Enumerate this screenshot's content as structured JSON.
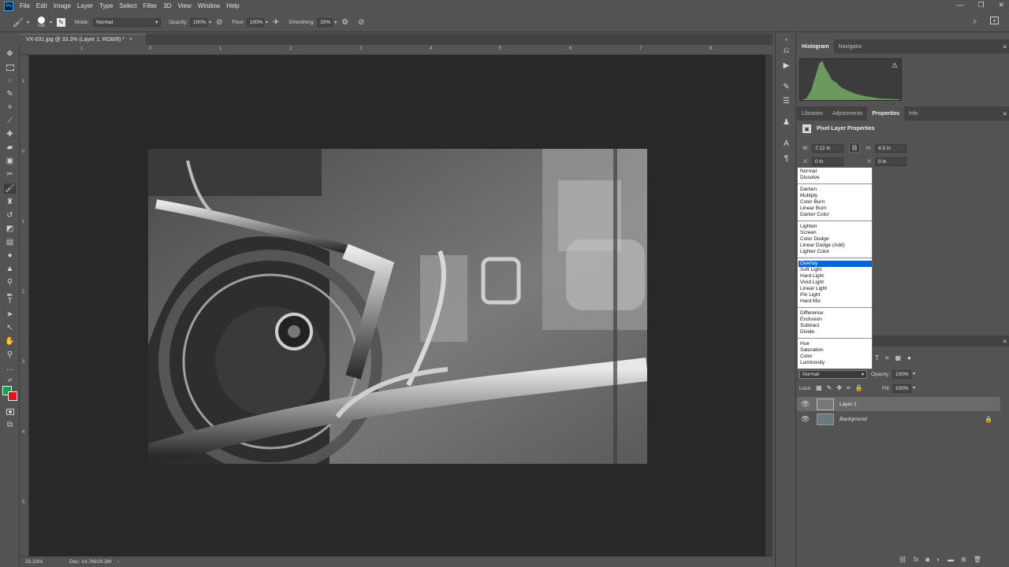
{
  "menu": {
    "logo": "Ps",
    "items": [
      "File",
      "Edit",
      "Image",
      "Layer",
      "Type",
      "Select",
      "Filter",
      "3D",
      "View",
      "Window",
      "Help"
    ]
  },
  "options_bar": {
    "brush_size": "139",
    "mode_label": "Mode:",
    "mode_value": "Normal",
    "opacity_label": "Opacity:",
    "opacity_value": "100%",
    "flow_label": "Flow:",
    "flow_value": "100%",
    "smoothing_label": "Smoothing:",
    "smoothing_value": "10%"
  },
  "document": {
    "tab_title": "VX-031.jpg @ 33.3% (Layer 1, RGB/8) *",
    "close_glyph": "×",
    "zoom": "33.33%",
    "doc_info": "Doc: 14.7M/29.3M"
  },
  "rulers": {
    "horizontal": [
      "1",
      "0",
      "1",
      "2",
      "3",
      "4",
      "5",
      "6",
      "7",
      "8"
    ],
    "vertical": [
      "1",
      "0",
      "1",
      "2",
      "3",
      "4",
      "5"
    ]
  },
  "panels": {
    "top_tabs": [
      "Histogram",
      "Navigator"
    ],
    "mid_tabs": [
      "Libraries",
      "Adjustments",
      "Properties",
      "Info"
    ],
    "properties_title": "Pixel Layer Properties",
    "w_label": "W:",
    "w_value": "7.12 in",
    "h_label": "H:",
    "h_value": "4.5 in",
    "x_label": "X:",
    "x_value": "0 in",
    "y_label": "Y:",
    "y_value": "0 in"
  },
  "blend_modes": {
    "selected": "Overlay",
    "groups": [
      [
        "Normal",
        "Dissolve"
      ],
      [
        "Darken",
        "Multiply",
        "Color Burn",
        "Linear Burn",
        "Darker Color"
      ],
      [
        "Lighten",
        "Screen",
        "Color Dodge",
        "Linear Dodge (Add)",
        "Lighter Color"
      ],
      [
        "Overlay",
        "Soft Light",
        "Hard Light",
        "Vivid Light",
        "Linear Light",
        "Pin Light",
        "Hard Mix"
      ],
      [
        "Difference",
        "Exclusion",
        "Subtract",
        "Divide"
      ],
      [
        "Hue",
        "Saturation",
        "Color",
        "Luminosity"
      ]
    ]
  },
  "layers": {
    "blend_value": "Normal",
    "opacity_label": "Opacity:",
    "opacity_value": "100%",
    "lock_label": "Lock:",
    "fill_label": "Fill:",
    "fill_value": "100%",
    "items": [
      {
        "name": "Layer 1",
        "selected": true
      },
      {
        "name": "Background",
        "selected": false
      }
    ]
  },
  "colors": {
    "foreground": "#00a651",
    "background": "#e0141b"
  }
}
